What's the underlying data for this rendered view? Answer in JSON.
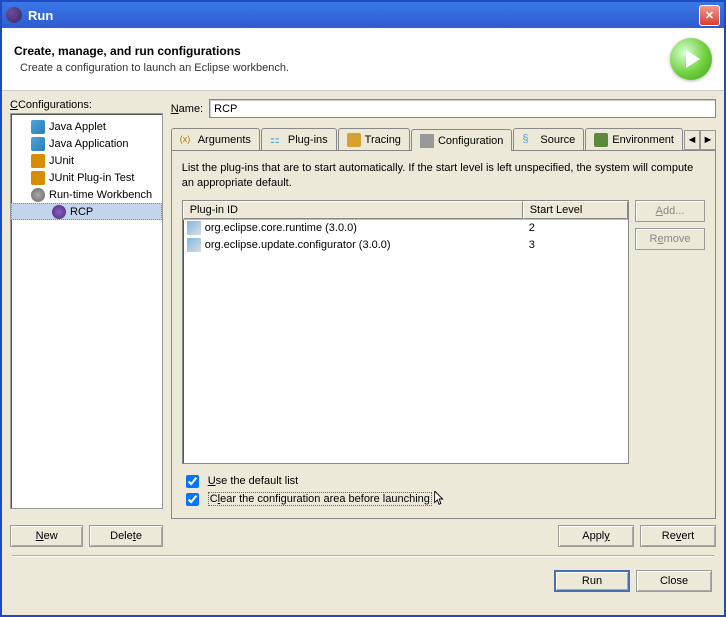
{
  "title": "Run",
  "header": {
    "title": "Create, manage, and run configurations",
    "subtitle": "Create a configuration to launch an Eclipse workbench."
  },
  "left": {
    "label": "Configurations:",
    "items": [
      {
        "label": "Java Applet"
      },
      {
        "label": "Java Application"
      },
      {
        "label": "JUnit"
      },
      {
        "label": "JUnit Plug-in Test"
      },
      {
        "label": "Run-time Workbench"
      },
      {
        "label": "RCP"
      }
    ],
    "new_btn": "New",
    "delete_btn": "Delete"
  },
  "name": {
    "label": "Name:",
    "value": "RCP"
  },
  "tabs": {
    "items": [
      "Arguments",
      "Plug-ins",
      "Tracing",
      "Configuration",
      "Source",
      "Environment"
    ]
  },
  "config_tab": {
    "hint": "List the plug-ins that are to start automatically.  If the start level is left unspecified, the system will compute an appropriate default.",
    "columns": {
      "id": "Plug-in ID",
      "start": "Start Level"
    },
    "rows": [
      {
        "id": "org.eclipse.core.runtime (3.0.0)",
        "start": "2"
      },
      {
        "id": "org.eclipse.update.configurator (3.0.0)",
        "start": "3"
      }
    ],
    "add_btn": "Add...",
    "remove_btn": "Remove",
    "check1": "Use the default list",
    "check2": "Clear the configuration area before launching"
  },
  "right_btns": {
    "apply": "Apply",
    "revert": "Revert"
  },
  "footer": {
    "run": "Run",
    "close": "Close"
  }
}
